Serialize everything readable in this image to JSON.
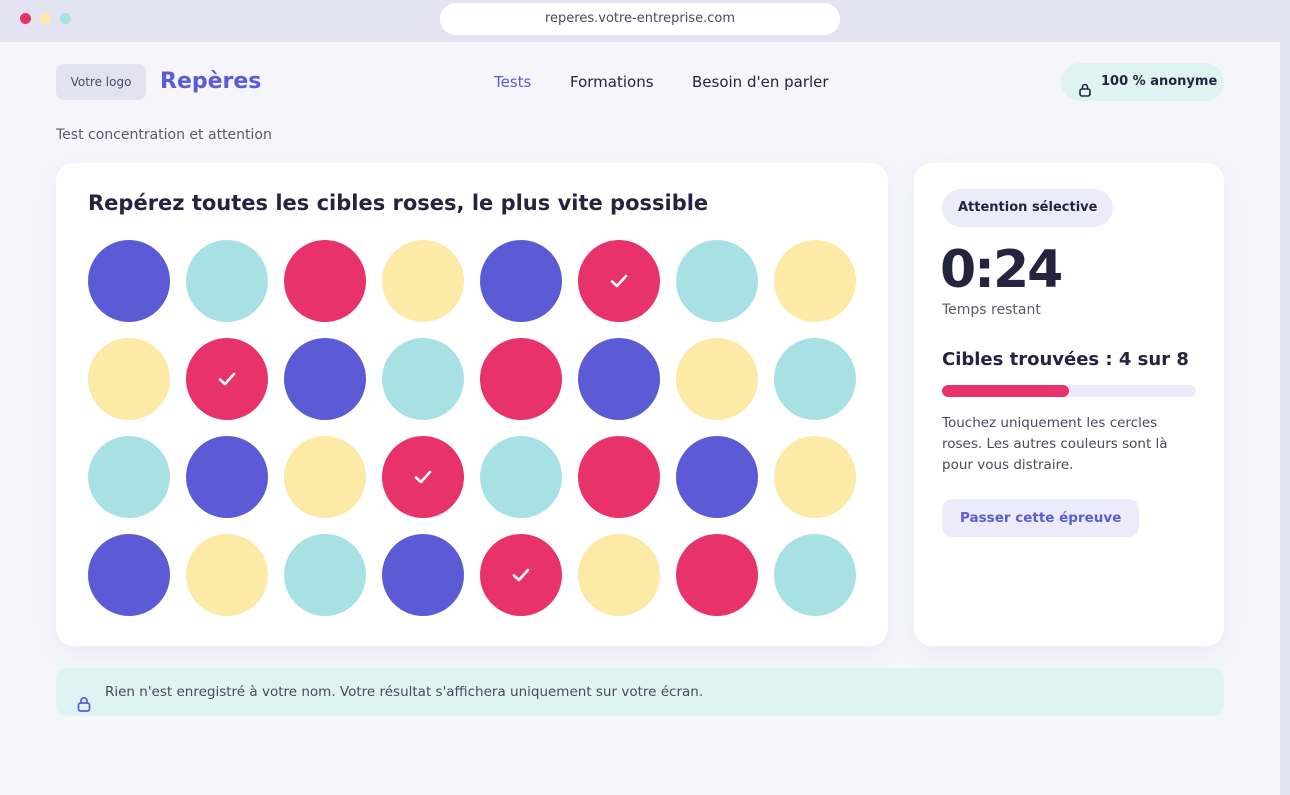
{
  "browser": {
    "url": "reperes.votre-entreprise.com"
  },
  "header": {
    "logo_placeholder": "Votre logo",
    "brand": "Repères",
    "nav": [
      {
        "label": "Tests",
        "active": true
      },
      {
        "label": "Formations",
        "active": false
      },
      {
        "label": "Besoin d'en parler",
        "active": false
      }
    ],
    "anonymous_badge": "100 % anonyme",
    "lock_icon": "lock-icon"
  },
  "page": {
    "subtitle": "Test concentration et attention"
  },
  "game": {
    "title": "Repérez toutes les cibles roses, le plus vite possible",
    "colors": {
      "indigo": "#5b5bd6",
      "teal": "#a8e1e4",
      "pink": "#e8336a",
      "yellow": "#fdeaa6"
    },
    "grid": [
      [
        {
          "color": "indigo"
        },
        {
          "color": "teal"
        },
        {
          "color": "pink"
        },
        {
          "color": "yellow"
        },
        {
          "color": "indigo"
        },
        {
          "color": "pink",
          "found": true
        },
        {
          "color": "teal"
        },
        {
          "color": "yellow"
        }
      ],
      [
        {
          "color": "yellow"
        },
        {
          "color": "pink",
          "found": true
        },
        {
          "color": "indigo"
        },
        {
          "color": "teal"
        },
        {
          "color": "pink"
        },
        {
          "color": "indigo"
        },
        {
          "color": "yellow"
        },
        {
          "color": "teal"
        }
      ],
      [
        {
          "color": "teal"
        },
        {
          "color": "indigo"
        },
        {
          "color": "yellow"
        },
        {
          "color": "pink",
          "found": true
        },
        {
          "color": "teal"
        },
        {
          "color": "pink"
        },
        {
          "color": "indigo"
        },
        {
          "color": "yellow"
        }
      ],
      [
        {
          "color": "indigo"
        },
        {
          "color": "yellow"
        },
        {
          "color": "teal"
        },
        {
          "color": "indigo"
        },
        {
          "color": "pink",
          "found": true
        },
        {
          "color": "yellow"
        },
        {
          "color": "pink"
        },
        {
          "color": "teal"
        }
      ]
    ]
  },
  "side": {
    "tag": "Attention sélective",
    "timer": "0:24",
    "timer_label": "Temps restant",
    "found_text": "Cibles trouvées : 4 sur 8",
    "progress": 0.5,
    "instructions": "Touchez uniquement les cercles roses. Les autres couleurs sont là pour vous distraire.",
    "skip_button": "Passer cette épreuve"
  },
  "footer": {
    "note": "Rien n'est enregistré à votre nom. Votre résultat s'affichera uniquement sur votre écran."
  }
}
